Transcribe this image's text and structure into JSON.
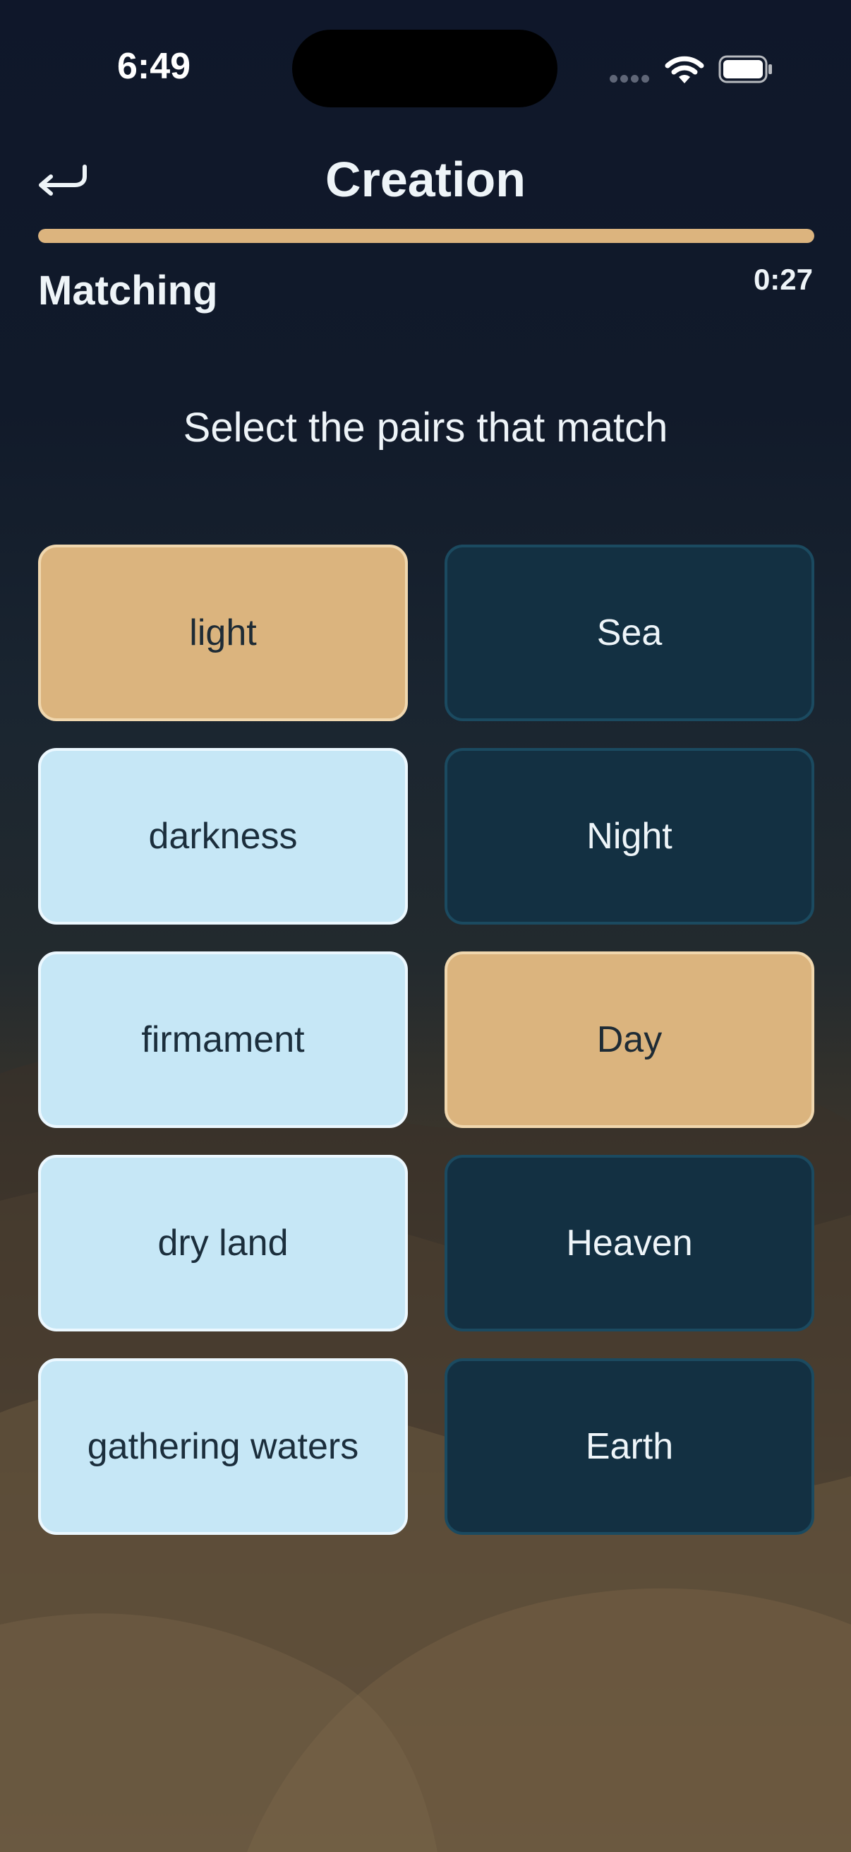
{
  "status_bar": {
    "time": "6:49",
    "icons": [
      "cellular-signal-icon",
      "wifi-icon",
      "battery-icon"
    ]
  },
  "header": {
    "back_icon": "return-arrow-icon",
    "title": "Creation"
  },
  "progress": {
    "fraction": 1.0
  },
  "mode_label": "Matching",
  "timer": "0:27",
  "prompt": "Select the pairs that match",
  "tiles": {
    "left": [
      {
        "label": "light",
        "state": "selected"
      },
      {
        "label": "darkness",
        "state": "default"
      },
      {
        "label": "firmament",
        "state": "default"
      },
      {
        "label": "dry land",
        "state": "default"
      },
      {
        "label": "gathering waters",
        "state": "default"
      }
    ],
    "right": [
      {
        "label": "Sea",
        "state": "default"
      },
      {
        "label": "Night",
        "state": "default"
      },
      {
        "label": "Day",
        "state": "selected"
      },
      {
        "label": "Heaven",
        "state": "default"
      },
      {
        "label": "Earth",
        "state": "default"
      }
    ]
  },
  "colors": {
    "accent": "#dcb47e",
    "term_tile": "#c6e7f6",
    "answer_tile": "#133042",
    "background_top": "#0f172a",
    "background_bottom": "#8a7253"
  }
}
